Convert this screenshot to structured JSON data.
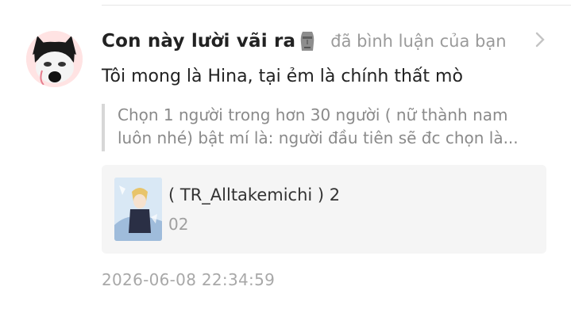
{
  "notification": {
    "username": "Con này lười vãi ra",
    "username_emoji": "moai-icon",
    "action": "đã bình luận của bạn",
    "comment": "Tôi mong là Hina, tại ẻm là chính thất mò",
    "quoted_text": "Chọn 1 người trong hơn 30 người ( nữ thành nam luôn nhé) bật mí là: người đầu tiên sẽ đc chọn là...",
    "story": {
      "title": "( TR_Alltakemichi ) 2",
      "subtitle": "02"
    },
    "timestamp": "2026-06-08 22:34:59"
  },
  "colors": {
    "username": "#222222",
    "action": "#9a9a9a",
    "quote_border": "#d7d7d7",
    "card_bg": "#f5f5f5",
    "timestamp": "#a8a8a8"
  }
}
